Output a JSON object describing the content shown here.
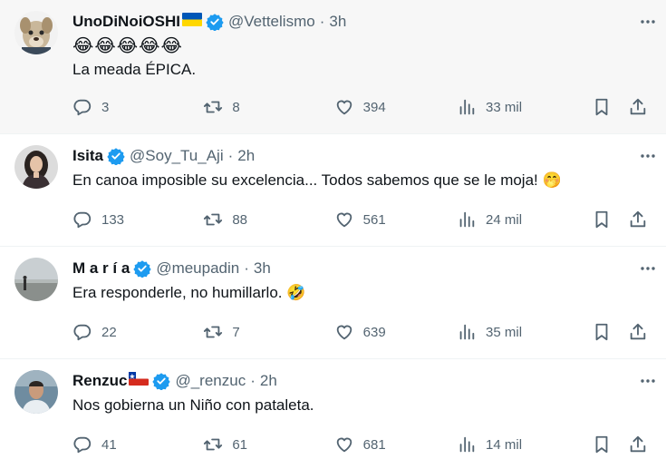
{
  "colors": {
    "verified": "#1d9bf0",
    "secondary_text": "#536471",
    "highlight_bg": "#f7f7f7"
  },
  "tweets": [
    {
      "name": "UnoDiNoiOSHI",
      "name_flag": "ukraine-flag-icon",
      "handle": "@Vettelismo",
      "separator": "·",
      "time": "3h",
      "emoji_line": "😂😂😂😂😂",
      "text": "La meada ÉPICA.",
      "replies": "3",
      "retweets": "8",
      "likes": "394",
      "views": "33 mil"
    },
    {
      "name": "Isita",
      "handle": "@Soy_Tu_Aji",
      "separator": "·",
      "time": "2h",
      "text": "En canoa imposible su excelencia... Todos sabemos que se le moja! 🤭",
      "replies": "133",
      "retweets": "88",
      "likes": "561",
      "views": "24 mil"
    },
    {
      "name": "M a r í a",
      "handle": "@meupadin",
      "separator": "·",
      "time": "3h",
      "text": "Era responderle, no humillarlo. 🤣",
      "replies": "22",
      "retweets": "7",
      "likes": "639",
      "views": "35 mil"
    },
    {
      "name": "Renzuc",
      "name_flag": "chile-flag-icon",
      "handle": "@_renzuc",
      "separator": "·",
      "time": "2h",
      "text": "Nos gobierna un Niño con pataleta.",
      "replies": "41",
      "retweets": "61",
      "likes": "681",
      "views": "14 mil"
    }
  ]
}
